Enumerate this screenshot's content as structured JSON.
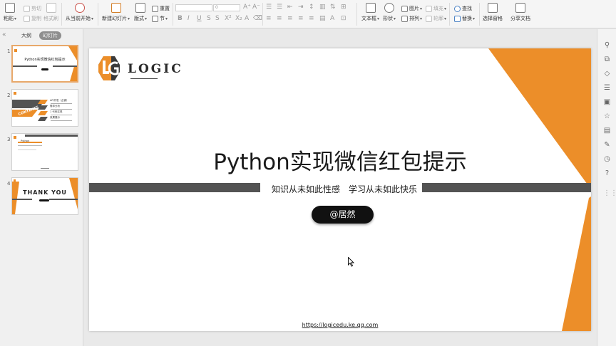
{
  "ribbon": {
    "clipboard": {
      "paste": "粘贴",
      "cut": "剪切",
      "copy": "复制",
      "format_painter": "格式刷"
    },
    "from_current": "从当前开始",
    "new_slide": "新建幻灯片",
    "layout": "版式",
    "reset": "重置",
    "section": "节",
    "font_size_value": "0",
    "textbox": "文本框",
    "shape": "形状",
    "picture": "图片",
    "fill": "填充",
    "arrange": "排列",
    "outline": "轮廓",
    "find": "查找",
    "replace": "替换",
    "select_pane": "选择窗格",
    "share_doc": "分享文档"
  },
  "left_panel": {
    "tab_outline": "大纲",
    "tab_slides": "幻灯片",
    "thumbnails": [
      {
        "num": "1",
        "title": "Python实现微信红包提示"
      },
      {
        "num": "2",
        "title": "CONTENTS",
        "items": [
          "API开发（企微）",
          "需求分析",
          "1 代码实现",
          "效果展示"
        ]
      },
      {
        "num": "3",
        "title": "Python"
      },
      {
        "num": "4",
        "title": "THANK YOU"
      }
    ]
  },
  "slide": {
    "logo_text": "LOGIC",
    "title": "Python实现微信红包提示",
    "subtitle_left": "知识从未如此性感",
    "subtitle_right": "学习从未如此快乐",
    "author": "@居然",
    "url": "https://logicedu.ke.qq.com"
  },
  "colors": {
    "accent_orange": "#ec8e29",
    "bar_gray": "#535353",
    "pill_black": "#111111"
  }
}
